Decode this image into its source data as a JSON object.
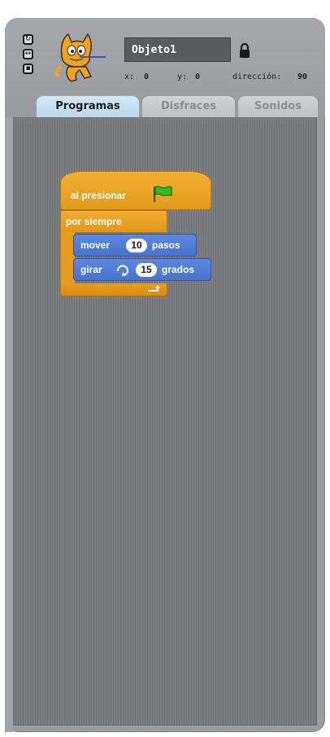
{
  "sprite": {
    "name": "Objeto1",
    "x_label": "x:",
    "x_value": "0",
    "y_label": "y:",
    "y_value": "0",
    "direction_label": "dirección:",
    "direction_value": "90"
  },
  "tabs": [
    {
      "label": "Programas",
      "active": true
    },
    {
      "label": "Disfraces",
      "active": false
    },
    {
      "label": "Sonidos",
      "active": false
    }
  ],
  "scripts": {
    "hat_label": "al presionar",
    "forever_label": "por siempre",
    "move": {
      "label_pre": "mover",
      "value": "10",
      "label_post": "pasos"
    },
    "turn": {
      "label_pre": "girar",
      "value": "15",
      "label_post": "grados"
    }
  },
  "colors": {
    "control": "#e6a024",
    "motion": "#4a73cc",
    "tab_active": "#c3dcec"
  }
}
